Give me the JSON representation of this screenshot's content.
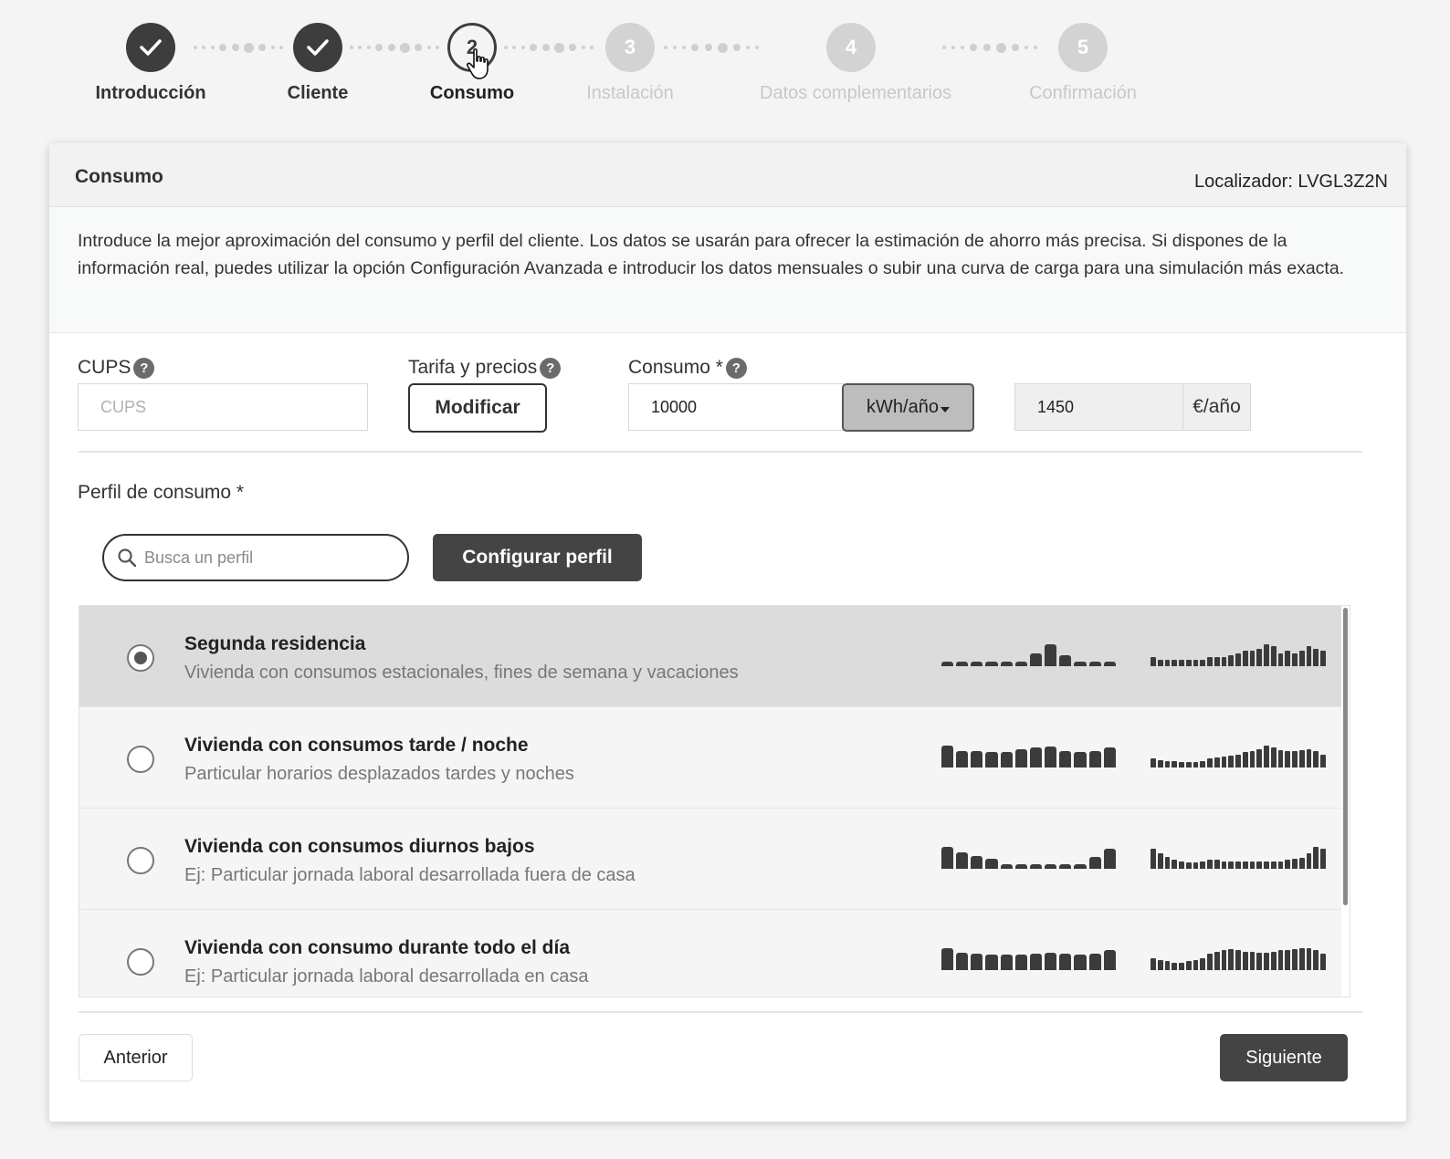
{
  "stepper": {
    "steps": [
      {
        "label": "Introducción",
        "state": "done",
        "marker": "check-icon"
      },
      {
        "label": "Cliente",
        "state": "done",
        "marker": "check-icon"
      },
      {
        "label": "Consumo",
        "state": "current",
        "number": "2"
      },
      {
        "label": "Instalación",
        "state": "todo",
        "number": "3"
      },
      {
        "label": "Datos complementarios",
        "state": "todo",
        "number": "4"
      },
      {
        "label": "Confirmación",
        "state": "todo",
        "number": "5"
      }
    ]
  },
  "card": {
    "title": "Consumo",
    "localizador": "Localizador: LVGL3Z2N",
    "intro": "Introduce la mejor aproximación del consumo y perfil del cliente. Los datos se usarán para ofrecer la estimación de ahorro más precisa. Si dispones de la información real, puedes utilizar la opción Configuración Avanzada e introducir los datos mensuales o subir una curva de carga para una simulación más exacta."
  },
  "form": {
    "cups_label": "CUPS",
    "cups_placeholder": "CUPS",
    "cups_value": "",
    "tarifa_label": "Tarifa y precios",
    "modificar_label": "Modificar",
    "consumo_label": "Consumo *",
    "consumo_value": "10000",
    "consumo_unit": "kWh/año",
    "cost_value": "1450",
    "cost_unit": "€/año",
    "help_glyph": "?"
  },
  "perfil": {
    "label": "Perfil de consumo *",
    "search_placeholder": "Busca un perfil",
    "configurar_label": "Configurar perfil",
    "profiles": [
      {
        "title": "Segunda residencia",
        "description": "Vivienda con consumos estacionales, fines de semana y vacaciones",
        "selected": true,
        "monthly": [
          0.2,
          0.2,
          0.2,
          0.2,
          0.2,
          0.2,
          0.6,
          1.0,
          0.5,
          0.2,
          0.2,
          0.2
        ],
        "hourly": [
          0.4,
          0.3,
          0.3,
          0.3,
          0.3,
          0.3,
          0.3,
          0.3,
          0.4,
          0.4,
          0.4,
          0.5,
          0.6,
          0.7,
          0.7,
          0.8,
          1.0,
          0.9,
          0.6,
          0.7,
          0.6,
          0.7,
          0.9,
          0.8,
          0.7
        ]
      },
      {
        "title": "Vivienda con consumos tarde / noche",
        "description": "Particular horarios desplazados tardes y noches",
        "selected": false,
        "monthly": [
          1.0,
          0.75,
          0.75,
          0.7,
          0.7,
          0.85,
          0.9,
          0.95,
          0.75,
          0.7,
          0.75,
          0.9
        ],
        "hourly": [
          0.4,
          0.35,
          0.3,
          0.3,
          0.25,
          0.25,
          0.25,
          0.3,
          0.4,
          0.45,
          0.5,
          0.55,
          0.6,
          0.7,
          0.75,
          0.85,
          1.0,
          0.9,
          0.8,
          0.75,
          0.75,
          0.8,
          0.85,
          0.75,
          0.6
        ]
      },
      {
        "title": "Vivienda con consumos diurnos bajos",
        "description": "Ej: Particular jornada laboral desarrollada fuera de casa",
        "selected": false,
        "monthly": [
          1.0,
          0.75,
          0.6,
          0.45,
          0.2,
          0.2,
          0.2,
          0.2,
          0.2,
          0.2,
          0.55,
          0.9
        ],
        "hourly": [
          0.9,
          0.7,
          0.55,
          0.4,
          0.35,
          0.3,
          0.3,
          0.35,
          0.4,
          0.4,
          0.35,
          0.35,
          0.35,
          0.35,
          0.35,
          0.35,
          0.35,
          0.35,
          0.35,
          0.4,
          0.45,
          0.5,
          0.7,
          1.0,
          0.9
        ]
      },
      {
        "title": "Vivienda con consumo durante todo el día",
        "description": "Ej: Particular jornada laboral desarrollada en casa",
        "selected": false,
        "monthly": [
          1.0,
          0.8,
          0.75,
          0.7,
          0.7,
          0.7,
          0.75,
          0.8,
          0.75,
          0.7,
          0.75,
          0.9
        ],
        "hourly": [
          0.55,
          0.45,
          0.4,
          0.35,
          0.35,
          0.4,
          0.45,
          0.55,
          0.75,
          0.85,
          0.9,
          0.95,
          0.9,
          0.85,
          0.85,
          0.8,
          0.8,
          0.85,
          0.9,
          0.9,
          0.95,
          1.0,
          1.0,
          0.9,
          0.75
        ]
      }
    ]
  },
  "footer": {
    "anterior_label": "Anterior",
    "siguiente_label": "Siguiente"
  },
  "colors": {
    "primary_dark": "#444444",
    "done_step": "#3d3d3d",
    "todo_step": "#d3d3d3",
    "selected_row": "#dcdcdc"
  }
}
